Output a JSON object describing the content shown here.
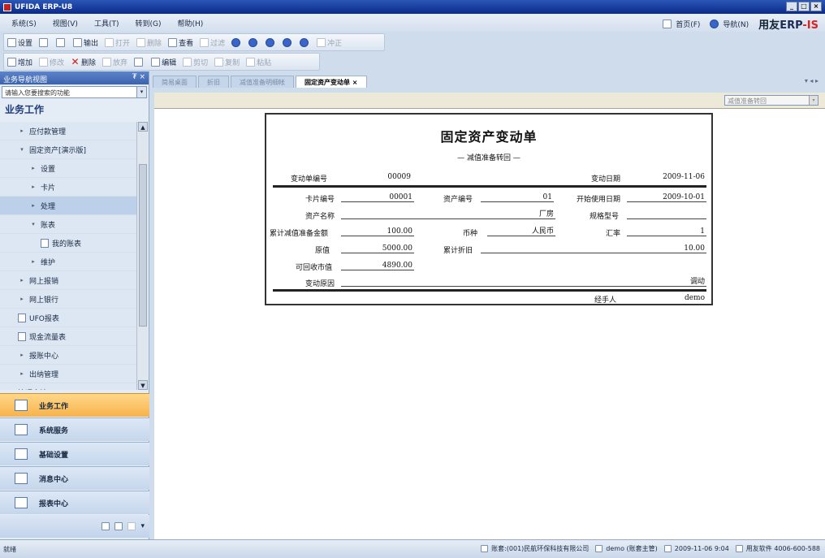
{
  "window": {
    "title": "UFIDA ERP-U8"
  },
  "menu": [
    "系统(S)",
    "视图(V)",
    "工具(T)",
    "转到(G)",
    "帮助(H)"
  ],
  "header_links": {
    "home": "首页(F)",
    "nav": "导航(N)",
    "brand_a": "用友",
    "brand_b": "ERP",
    "brand_c": "-IS"
  },
  "toolbar1": [
    "设置",
    "",
    "",
    "输出",
    "打开",
    "删除",
    "查看",
    "过滤",
    "",
    "",
    "",
    "",
    "",
    "",
    "冲正"
  ],
  "toolbar2": [
    "增加",
    "修改",
    "删除",
    "放弃",
    "",
    "编辑",
    "剪切",
    "复制",
    "粘贴"
  ],
  "left_panel": {
    "title": "业务导航视图",
    "pin": "₮ ×",
    "search_placeholder": "请输入您要搜索的功能",
    "section": "业务工作",
    "tree": [
      {
        "label": "应付款管理",
        "indent": 1,
        "arrow": "▸"
      },
      {
        "label": "固定资产[演示版]",
        "indent": 1,
        "arrow": "▾"
      },
      {
        "label": "设置",
        "indent": 2,
        "arrow": "▸"
      },
      {
        "label": "卡片",
        "indent": 2,
        "arrow": "▸"
      },
      {
        "label": "处理",
        "indent": 2,
        "arrow": "▸",
        "selected": true
      },
      {
        "label": "账表",
        "indent": 2,
        "arrow": "▾"
      },
      {
        "label": "我的账表",
        "indent": 3,
        "arrow": ""
      },
      {
        "label": "维护",
        "indent": 2,
        "arrow": "▸"
      },
      {
        "label": "网上报销",
        "indent": 1,
        "arrow": "▸"
      },
      {
        "label": "网上银行",
        "indent": 1,
        "arrow": "▸"
      },
      {
        "label": "UFO报表",
        "indent": 1,
        "arrow": ""
      },
      {
        "label": "现金流量表",
        "indent": 1,
        "arrow": ""
      },
      {
        "label": "报账中心",
        "indent": 1,
        "arrow": "▸"
      },
      {
        "label": "出纳管理",
        "indent": 1,
        "arrow": "▸"
      },
      {
        "label": "管理会计",
        "indent": 0,
        "arrow": "▸"
      }
    ],
    "nav_buttons": [
      "业务工作",
      "系统服务",
      "基础设置",
      "消息中心",
      "报表中心"
    ]
  },
  "tabs": [
    "简易桌面",
    "折旧",
    "减值准备明细帐",
    "固定资产变动单"
  ],
  "tab_close": "×",
  "tab_more": "▾ ◂ ▸",
  "doc_select": "减值准备转回",
  "form": {
    "title": "固定资产变动单",
    "subtitle": "— 减值准备转回 —",
    "fields": {
      "change_no_label": "变动单编号",
      "change_no": "00009",
      "change_date_label": "变动日期",
      "change_date": "2009-11-06",
      "card_no_label": "卡片编号",
      "card_no": "00001",
      "asset_no_label": "资产编号",
      "asset_no": "01",
      "start_date_label": "开始使用日期",
      "start_date": "2009-10-01",
      "asset_name_label": "资产名称",
      "asset_name": "厂房",
      "spec_label": "规格型号",
      "spec": "",
      "impairment_label": "累计减值准备金额",
      "impairment": "100.00",
      "currency_label": "币种",
      "currency": "人民币",
      "rate_label": "汇率",
      "rate": "1",
      "orig_value_label": "原值",
      "orig_value": "5000.00",
      "dep_label": "累计折旧",
      "dep": "10.00",
      "recoverable_label": "可回收市值",
      "recoverable": "4890.00",
      "reason_label": "变动原因",
      "reason": "调动",
      "handler_label": "经手人",
      "handler": "demo"
    }
  },
  "status": {
    "left": "就绪",
    "account": "账套:(001)民航环保科技有限公司",
    "user": "demo (账套主管)",
    "datetime": "2009-11-06 9:04",
    "hotline": "用友软件 4006-600-588"
  }
}
